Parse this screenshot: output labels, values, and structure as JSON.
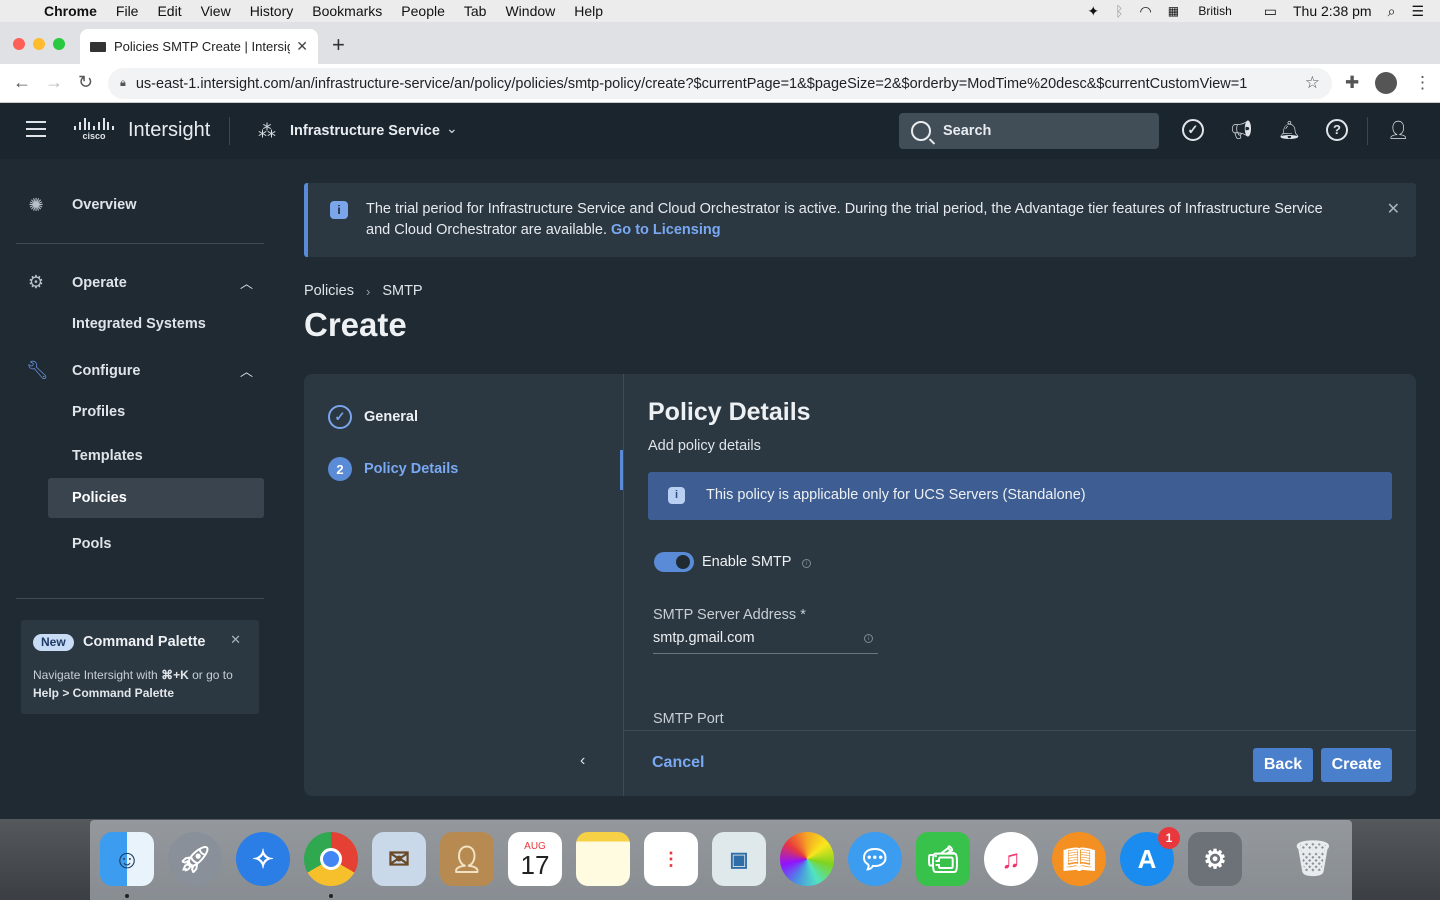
{
  "menubar": {
    "app": "Chrome",
    "items": [
      "File",
      "Edit",
      "View",
      "History",
      "Bookmarks",
      "People",
      "Tab",
      "Window",
      "Help"
    ],
    "input_source": "British",
    "clock": "Thu 2:38 pm"
  },
  "browser": {
    "tab_title": "Policies SMTP Create | Intersig",
    "url": "us-east-1.intersight.com/an/infrastructure-service/an/policy/policies/smtp-policy/create?$currentPage=1&$pageSize=2&$orderby=ModTime%20desc&$currentCustomView=1"
  },
  "header": {
    "brand": "cisco",
    "product": "Intersight",
    "service": "Infrastructure Service",
    "search_placeholder": "Search"
  },
  "sidebar": {
    "overview": "Overview",
    "operate": "Operate",
    "operate_items": [
      "Integrated Systems"
    ],
    "configure": "Configure",
    "configure_items": [
      "Profiles",
      "Templates",
      "Policies",
      "Pools"
    ],
    "active_item": "Policies",
    "command_palette": {
      "badge": "New",
      "title": "Command Palette",
      "body_pre": "Navigate Intersight with ",
      "shortcut": "⌘+K",
      "body_mid": " or go to ",
      "help_path": "Help > Command Palette"
    }
  },
  "banner": {
    "text": "The trial period for Infrastructure Service and Cloud Orchestrator is active. During the trial period, the Advantage tier features of Infrastructure Service and Cloud Orchestrator are available.",
    "link": "Go to Licensing"
  },
  "breadcrumb": [
    "Policies",
    "SMTP"
  ],
  "page_title": "Create",
  "wizard": {
    "steps": [
      {
        "number": "1",
        "label": "General",
        "state": "done"
      },
      {
        "number": "2",
        "label": "Policy Details",
        "state": "active"
      }
    ],
    "section_title": "Policy Details",
    "section_subtitle": "Add policy details",
    "info_text": "This policy is applicable only for UCS Servers (Standalone)",
    "toggle_label": "Enable SMTP",
    "toggle_on": true,
    "server_label": "SMTP Server Address *",
    "server_value": "smtp.gmail.com",
    "port_label": "SMTP Port",
    "cancel": "Cancel",
    "back": "Back",
    "create": "Create"
  },
  "dock": {
    "calendar_month": "AUG",
    "calendar_day": "17",
    "appstore_badge": "1"
  },
  "colors": {
    "accent": "#5a8bd6",
    "link": "#79a9f2",
    "surface": "#2b3741",
    "background": "#1f2a33",
    "header": "#1b252d"
  }
}
